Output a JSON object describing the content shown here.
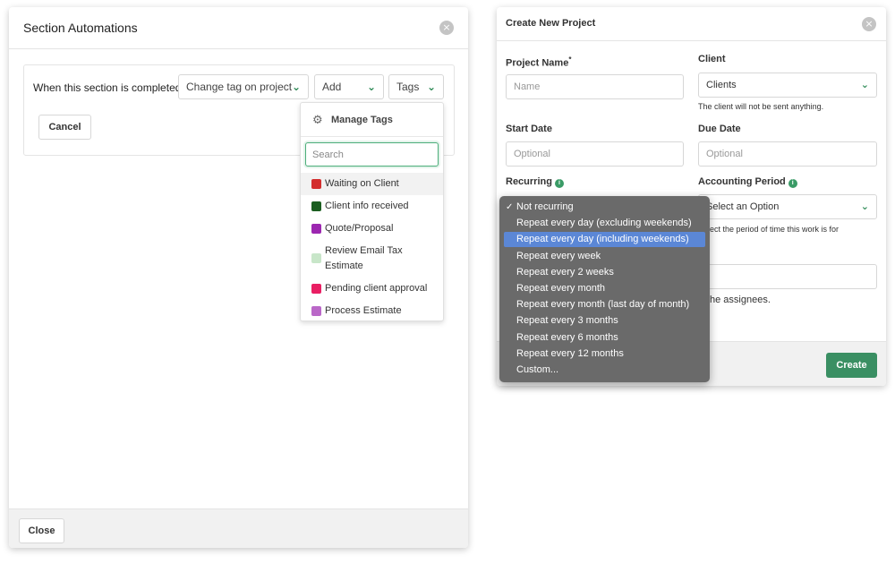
{
  "left_modal": {
    "title": "Section Automations",
    "close_icon": "×",
    "rule": {
      "trigger_label": "When this section is completed",
      "action_select": "Change tag on project",
      "add_select": "Add",
      "tags_select": "Tags",
      "cancel_label": "Cancel"
    },
    "tag_dropdown": {
      "manage_label": "Manage Tags",
      "search_placeholder": "Search",
      "items": [
        {
          "label": "Waiting on Client",
          "color": "#d32f2f"
        },
        {
          "label": "Client info received",
          "color": "#1b5e20"
        },
        {
          "label": "Quote/Proposal",
          "color": "#9c27b0"
        },
        {
          "label": "Review Email Tax Estimate",
          "color": "#c8e6c9"
        },
        {
          "label": "Pending client approval",
          "color": "#e91e63"
        },
        {
          "label": "Process Estimate",
          "color": "#ba68c8"
        }
      ]
    },
    "close_button": "Close"
  },
  "right_modal": {
    "title": "Create New Project",
    "close_icon": "×",
    "project_name": {
      "label": "Project Name",
      "required_mark": "*",
      "placeholder": "Name"
    },
    "client": {
      "label": "Client",
      "value": "Clients",
      "hint": "The client will not be sent anything."
    },
    "start_date": {
      "label": "Start Date",
      "placeholder": "Optional"
    },
    "due_date": {
      "label": "Due Date",
      "placeholder": "Optional"
    },
    "recurring": {
      "label": "Recurring"
    },
    "accounting_period": {
      "label": "Accounting Period",
      "value": "Select an Option",
      "hint": "ect the period of time this work is for"
    },
    "assignee_hint": "he assignees.",
    "create_button": "Create"
  },
  "recurring_menu": {
    "selected_index": 0,
    "highlighted_index": 2,
    "check_mark": "✓",
    "options": [
      "Not recurring",
      "Repeat every day (excluding weekends)",
      "Repeat every day (including weekends)",
      "Repeat every week",
      "Repeat every 2 weeks",
      "Repeat every month",
      "Repeat every month (last day of month)",
      "Repeat every 3 months",
      "Repeat every 6 months",
      "Repeat every 12 months",
      "Custom..."
    ]
  },
  "colors": {
    "accent_green": "#3a8f63",
    "menu_bg": "#6a6a6a",
    "menu_highlight": "#5b87d6"
  }
}
